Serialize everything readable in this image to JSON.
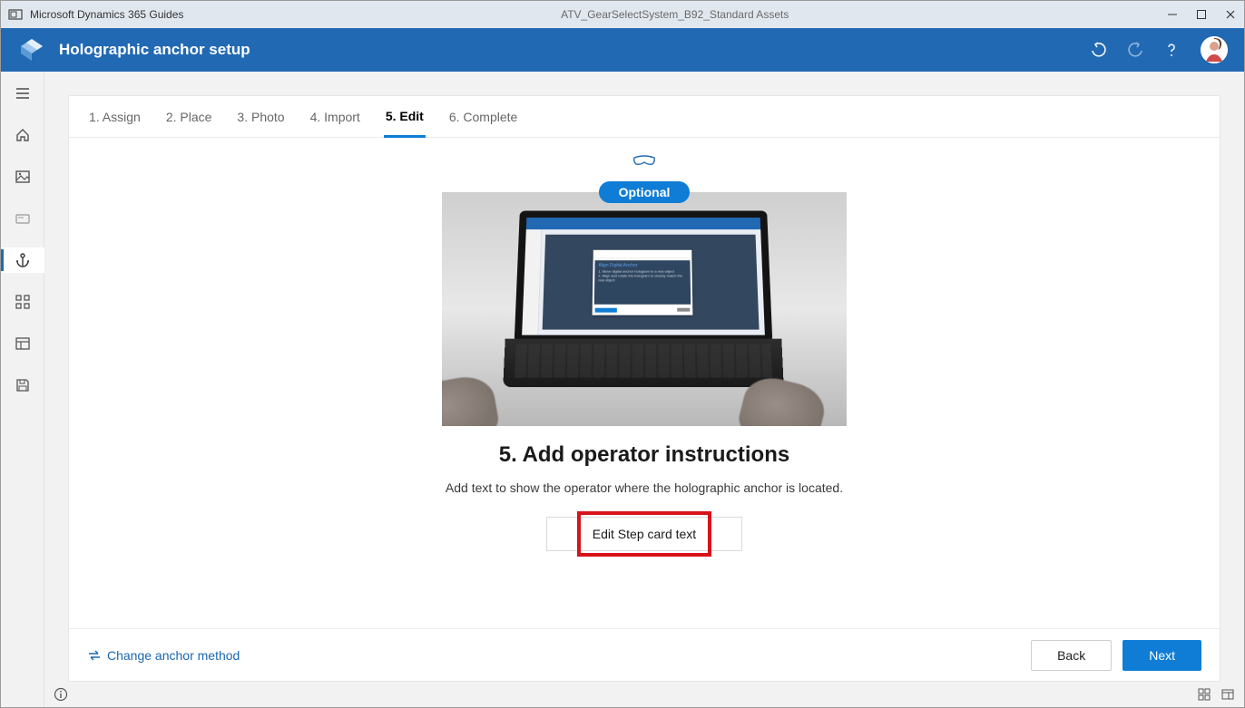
{
  "titlebar": {
    "app_title": "Microsoft Dynamics 365 Guides",
    "doc_title": "ATV_GearSelectSystem_B92_Standard Assets"
  },
  "header": {
    "page_title": "Holographic anchor setup"
  },
  "sidebar": {
    "items": [
      {
        "id": "menu",
        "icon": "menu-icon"
      },
      {
        "id": "home",
        "icon": "home-icon"
      },
      {
        "id": "image",
        "icon": "image-icon"
      },
      {
        "id": "card",
        "icon": "card-icon"
      },
      {
        "id": "anchor",
        "icon": "anchor-icon",
        "active": true
      },
      {
        "id": "apps",
        "icon": "apps-icon"
      },
      {
        "id": "layout",
        "icon": "layout-icon"
      },
      {
        "id": "save",
        "icon": "save-icon"
      }
    ]
  },
  "tabs": {
    "items": [
      {
        "label": "1. Assign"
      },
      {
        "label": "2. Place"
      },
      {
        "label": "3. Photo"
      },
      {
        "label": "4. Import"
      },
      {
        "label": "5. Edit",
        "active": true
      },
      {
        "label": "6. Complete"
      }
    ]
  },
  "main": {
    "pill": "Optional",
    "dialog_title": "Align Digital Anchor",
    "dialog_line1": "1. Move digital anchor hologram to a real object",
    "dialog_line2": "2. Align and rotate the hologram to closely match the real object",
    "heading": "5. Add operator instructions",
    "subheading": "Add text to show the operator where the holographic anchor is located.",
    "edit_button": "Edit Step card text"
  },
  "footer": {
    "change_link": "Change anchor method",
    "back": "Back",
    "next": "Next"
  }
}
